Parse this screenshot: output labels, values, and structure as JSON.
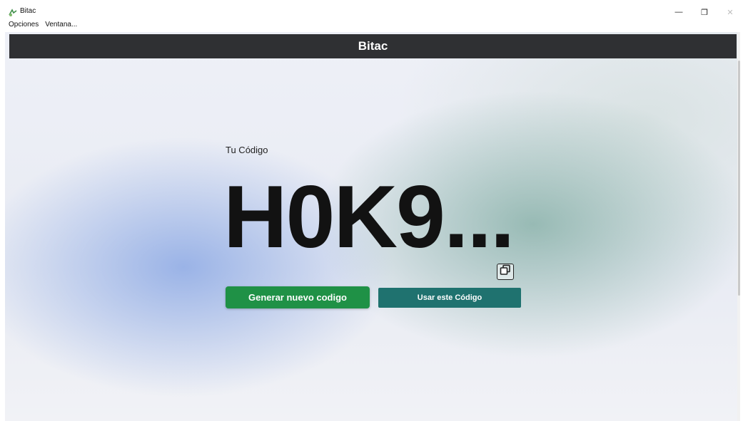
{
  "window": {
    "title": "Bitac",
    "controls": {
      "minimize": "—",
      "restore": "❐",
      "close": "✕"
    }
  },
  "menu": {
    "items": [
      "Opciones",
      "Ventana..."
    ]
  },
  "header": {
    "title": "Bitac"
  },
  "code": {
    "label": "Tu Código",
    "value": "H0K9..."
  },
  "actions": {
    "generate_label": "Generar nuevo codigo",
    "use_label": "Usar este Código"
  },
  "colors": {
    "header_bg": "#2f3033",
    "generate_bg": "#1f9146",
    "use_bg": "#1f726f"
  },
  "icons": {
    "app": "bitac-app-icon",
    "copy": "copy-icon"
  }
}
